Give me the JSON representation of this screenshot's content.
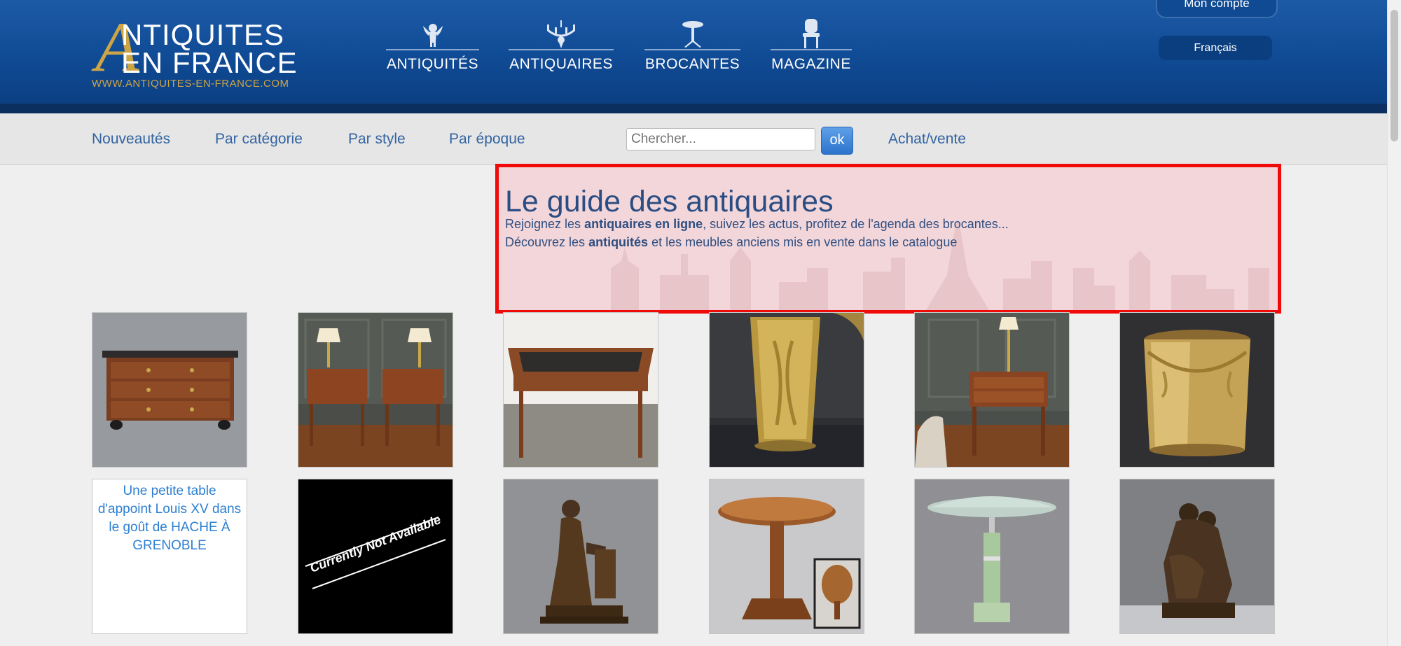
{
  "header": {
    "logo": {
      "letter": "A",
      "line1": "NTIQUITES",
      "line2": "EN FRANCE",
      "url": "WWW.ANTIQUITES-EN-FRANCE.COM"
    },
    "nav": [
      {
        "label": "ANTIQUITÉS",
        "icon": "cherub-icon"
      },
      {
        "label": "ANTIQUAIRES",
        "icon": "chandelier-icon"
      },
      {
        "label": "BROCANTES",
        "icon": "pedestal-table-icon"
      },
      {
        "label": "MAGAZINE",
        "icon": "chair-icon"
      }
    ],
    "account_label": "Mon compte",
    "language_label": "Français"
  },
  "subnav": {
    "links": [
      "Nouveautés",
      "Par catégorie",
      "Par style",
      "Par époque"
    ],
    "search_placeholder": "Chercher...",
    "search_button": "ok",
    "buy_sell_label": "Achat/vente"
  },
  "guide": {
    "title": "Le guide des antiquaires",
    "line1_before": "Rejoignez les ",
    "line1_bold": "antiquaires en ligne",
    "line1_after": ", suivez les actus, profitez de l'agenda des brocantes...",
    "line2_before": "Découvrez les ",
    "line2_bold": "antiquités",
    "line2_after": " et les meubles anciens mis en vente dans le catalogue"
  },
  "products": {
    "row2_alt_text": "Une petite table d'appoint Louis XV dans le goût de HACHE À GRENOBLE",
    "unavailable_text": "Currently Not Available"
  },
  "colors": {
    "header_blue": "#104b95",
    "gold": "#cea545",
    "link_blue": "#3264a2",
    "highlight_red": "#f00a0a"
  }
}
